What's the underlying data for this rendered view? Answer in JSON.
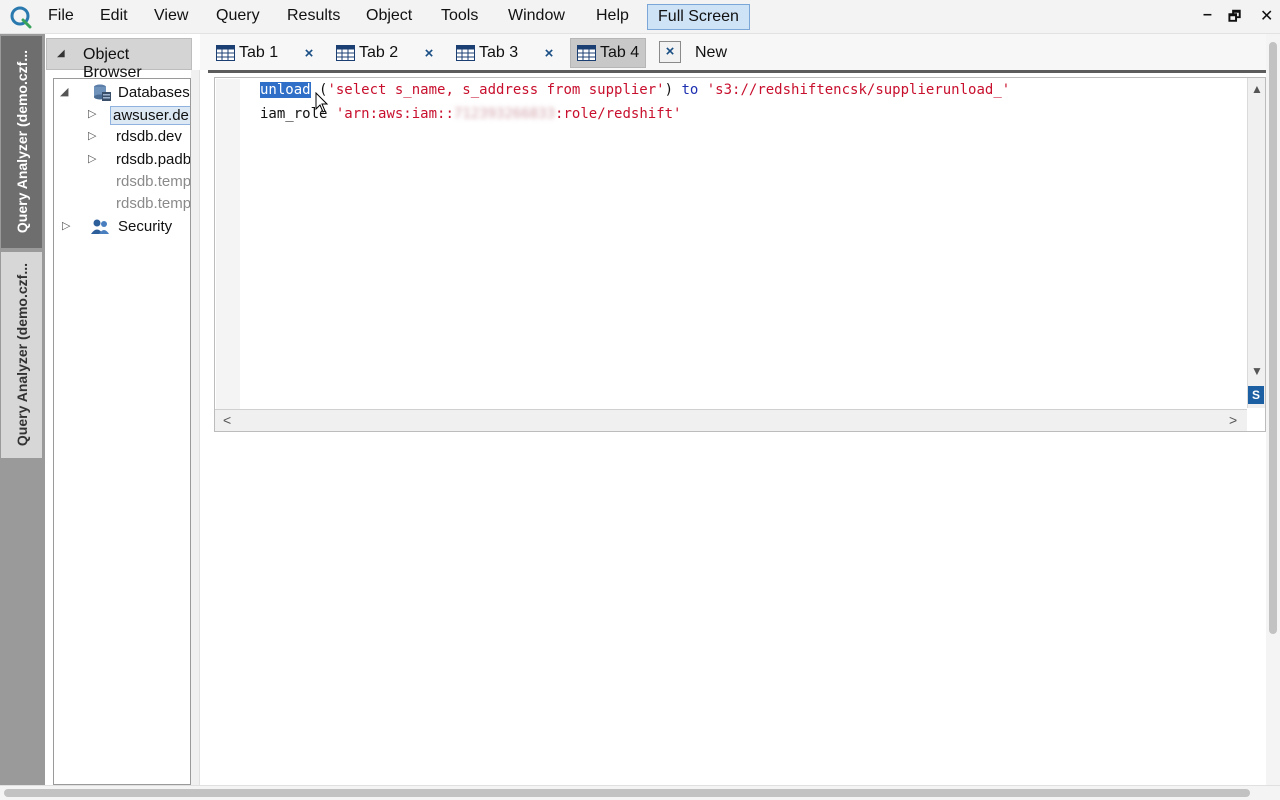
{
  "menu": {
    "items": [
      "File",
      "Edit",
      "View",
      "Query",
      "Results",
      "Object",
      "Tools",
      "Window",
      "Help"
    ],
    "fullscreen_label": "Full Screen"
  },
  "window_controls": {
    "minimize": "–",
    "restore": "🗗",
    "close": "✕"
  },
  "left_strip": {
    "tabs": [
      "Query Analyzer (demo.czf...",
      "Query Analyzer (demo.czf..."
    ]
  },
  "object_browser": {
    "title": "Object Browser",
    "tree": [
      {
        "label": "Databases",
        "expander": "◢",
        "icon": "database-icon"
      },
      {
        "label": "awsuser.de",
        "expander": "▷",
        "selected": true
      },
      {
        "label": "rdsdb.dev",
        "expander": "▷"
      },
      {
        "label": "rdsdb.padb",
        "expander": "▷"
      },
      {
        "label": "rdsdb.temp",
        "muted": true
      },
      {
        "label": "rdsdb.temp",
        "muted": true
      },
      {
        "label": "Security",
        "expander": "▷",
        "icon": "users-icon"
      }
    ]
  },
  "tabs": [
    {
      "label": "Tab 1",
      "close": "×"
    },
    {
      "label": "Tab 2",
      "close": "×"
    },
    {
      "label": "Tab 3",
      "close": "×"
    },
    {
      "label": "Tab 4",
      "close": "×",
      "active": true
    },
    {
      "label": "New"
    }
  ],
  "editor": {
    "line1": {
      "keyword": "unload",
      "open": " (",
      "query": "'select s_name, s_address from supplier'",
      "close": ") ",
      "to": "to",
      "space": " ",
      "target": "'s3://redshiftencsk/supplierunload_'"
    },
    "line2": {
      "keyword": "iam_role",
      "space": " ",
      "arn_prefix": "'arn:aws:iam::",
      "account_redacted": "712393266833",
      "arn_suffix": ":role/redshift'"
    },
    "scroll_up": "▲",
    "scroll_down": "▼",
    "scroll_left": "<",
    "scroll_right": ">",
    "corner_glyph": "S"
  },
  "colors": {
    "accent": "#2f6fc8",
    "string": "#c8102e",
    "keyword": "#1d2fb0",
    "strip": "#9a9a9a"
  }
}
